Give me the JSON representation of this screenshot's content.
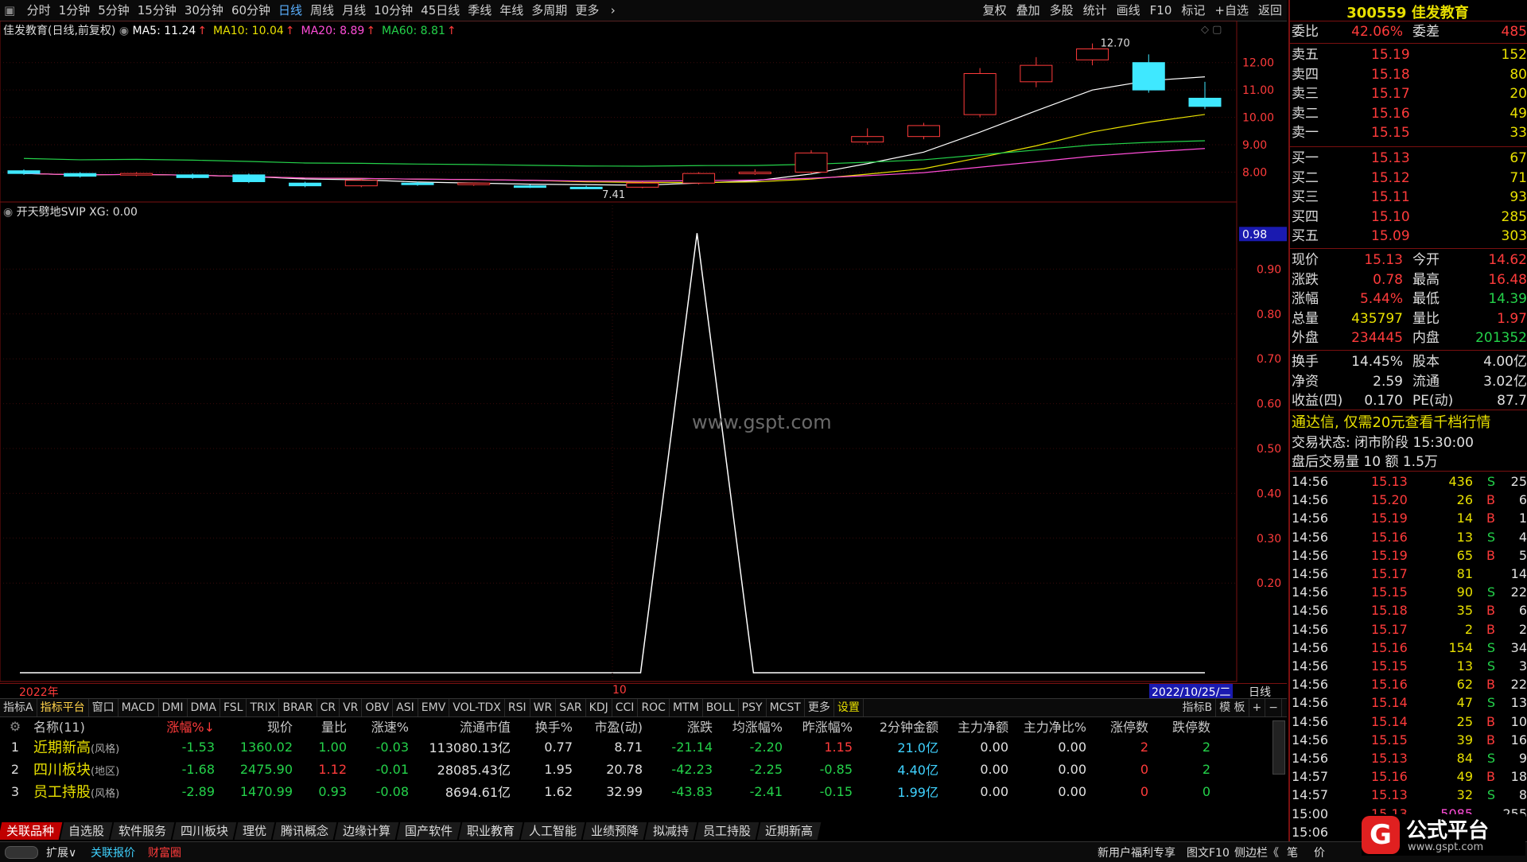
{
  "toolbar": {
    "periods": [
      "分时",
      "1分钟",
      "5分钟",
      "15分钟",
      "30分钟",
      "60分钟",
      "日线",
      "周线",
      "月线",
      "10分钟",
      "45日线",
      "季线",
      "年线",
      "多周期",
      "更多"
    ],
    "active": "日线",
    "right_tools": [
      "复权",
      "叠加",
      "多股",
      "统计",
      "画线",
      "F10",
      "标记",
      "+自选",
      "返回"
    ]
  },
  "chart": {
    "stock_title": "佳发教育(日线,前复权)",
    "ma": [
      {
        "label": "MA5: 11.24",
        "color": "#ffffff"
      },
      {
        "label": "MA10: 10.04",
        "color": "#e8e000"
      },
      {
        "label": "MA20: 8.89",
        "color": "#ff4dd8"
      },
      {
        "label": "MA60: 8.81",
        "color": "#24d24a"
      }
    ],
    "price_axis": [
      "12.00",
      "11.00",
      "10.00",
      "9.00",
      "8.00"
    ],
    "high_label": "12.70",
    "low_label": "7.41",
    "indicator_title": "开天劈地SVIP  XG: 0.00",
    "indicator_axis": [
      "0.98",
      "0.90",
      "0.80",
      "0.70",
      "0.60",
      "0.50",
      "0.40",
      "0.30",
      "0.20"
    ],
    "watermark": "www.gspt.com",
    "year_label": "2022年",
    "month_label": "10",
    "date_label": "2022/10/25/二",
    "period_label": "日线",
    "candles": [
      {
        "o": 8.05,
        "c": 7.95,
        "h": 8.1,
        "l": 7.9
      },
      {
        "o": 7.95,
        "c": 7.85,
        "h": 8.0,
        "l": 7.8
      },
      {
        "o": 7.9,
        "c": 7.95,
        "h": 8.0,
        "l": 7.85
      },
      {
        "o": 7.9,
        "c": 7.8,
        "h": 7.95,
        "l": 7.75
      },
      {
        "o": 7.9,
        "c": 7.65,
        "h": 7.95,
        "l": 7.6
      },
      {
        "o": 7.6,
        "c": 7.5,
        "h": 7.65,
        "l": 7.45
      },
      {
        "o": 7.5,
        "c": 7.7,
        "h": 7.75,
        "l": 7.45
      },
      {
        "o": 7.6,
        "c": 7.55,
        "h": 7.65,
        "l": 7.5
      },
      {
        "o": 7.55,
        "c": 7.6,
        "h": 7.62,
        "l": 7.5
      },
      {
        "o": 7.5,
        "c": 7.45,
        "h": 7.55,
        "l": 7.42
      },
      {
        "o": 7.45,
        "c": 7.41,
        "h": 7.5,
        "l": 7.41
      },
      {
        "o": 7.45,
        "c": 7.6,
        "h": 7.65,
        "l": 7.41
      },
      {
        "o": 7.6,
        "c": 7.95,
        "h": 8.0,
        "l": 7.55
      },
      {
        "o": 7.95,
        "c": 8.0,
        "h": 8.1,
        "l": 7.9
      },
      {
        "o": 8.0,
        "c": 8.7,
        "h": 8.8,
        "l": 7.95
      },
      {
        "o": 9.1,
        "c": 9.3,
        "h": 9.6,
        "l": 9.0
      },
      {
        "o": 9.3,
        "c": 9.7,
        "h": 9.8,
        "l": 9.2
      },
      {
        "o": 10.1,
        "c": 11.6,
        "h": 11.8,
        "l": 10.0
      },
      {
        "o": 11.3,
        "c": 11.9,
        "h": 12.2,
        "l": 11.1
      },
      {
        "o": 12.1,
        "c": 12.5,
        "h": 12.7,
        "l": 11.9
      },
      {
        "o": 12.0,
        "c": 11.0,
        "h": 12.3,
        "l": 10.9
      },
      {
        "o": 10.7,
        "c": 10.4,
        "h": 11.3,
        "l": 10.3
      }
    ],
    "spike_values": [
      0,
      0,
      0,
      0,
      0,
      0,
      0,
      0,
      0,
      0,
      0,
      0,
      0.98,
      0,
      0,
      0,
      0,
      0,
      0,
      0,
      0,
      0
    ]
  },
  "indicator_tabs": [
    "指标A",
    "指标平台",
    "窗口",
    "MACD",
    "DMI",
    "DMA",
    "FSL",
    "TRIX",
    "BRAR",
    "CR",
    "VR",
    "OBV",
    "ASI",
    "EMV",
    "VOL-TDX",
    "RSI",
    "WR",
    "SAR",
    "KDJ",
    "CCI",
    "ROC",
    "MTM",
    "BOLL",
    "PSY",
    "MCST",
    "更多",
    "设置"
  ],
  "indicator_tabs_right": [
    "指标B",
    "模 板",
    "+",
    "−"
  ],
  "table": {
    "headers": [
      "名称(11)",
      "涨幅%↓",
      "现价",
      "量比",
      "涨速%",
      "流通市值",
      "换手%",
      "市盈(动)",
      "涨跌",
      "均涨幅%",
      "昨涨幅%",
      "2分钟金额",
      "主力净额",
      "主力净比%",
      "涨停数",
      "跌停数"
    ],
    "rows": [
      {
        "idx": "1",
        "name": "近期新高",
        "tag": "(风格)",
        "vals": [
          "-1.53",
          "1360.02",
          "1.00",
          "-0.03",
          "113080.13亿",
          "0.77",
          "8.71",
          "-21.14",
          "-2.20",
          "1.15",
          "21.0亿",
          "0.00",
          "0.00",
          "2",
          "2"
        ]
      },
      {
        "idx": "2",
        "name": "四川板块",
        "tag": "(地区)",
        "vals": [
          "-1.68",
          "2475.90",
          "1.12",
          "-0.01",
          "28085.43亿",
          "1.95",
          "20.78",
          "-42.23",
          "-2.25",
          "-0.85",
          "4.40亿",
          "0.00",
          "0.00",
          "0",
          "2"
        ]
      },
      {
        "idx": "3",
        "name": "员工持股",
        "tag": "(风格)",
        "vals": [
          "-2.89",
          "1470.99",
          "0.93",
          "-0.08",
          "8694.61亿",
          "1.62",
          "32.99",
          "-43.83",
          "-2.41",
          "-0.15",
          "1.99亿",
          "0.00",
          "0.00",
          "0",
          "0"
        ]
      }
    ]
  },
  "sector_tabs": [
    "关联品种",
    "自选股",
    "软件服务",
    "四川板块",
    "理优",
    "腾讯概念",
    "边缘计算",
    "国产软件",
    "职业教育",
    "人工智能",
    "业绩预降",
    "拟减持",
    "员工持股",
    "近期新高"
  ],
  "status_bar": {
    "left": [
      "扩展∨",
      "关联报价",
      "财富圈"
    ],
    "right": [
      "新用户福利专享",
      "图文F10",
      "侧边栏《",
      "笔",
      "价"
    ]
  },
  "quote": {
    "header": "300559 佳发教育",
    "weibi": {
      "label": "委比",
      "pct": "42.06%",
      "label2": "委差",
      "val": "485"
    },
    "asks": [
      {
        "label": "卖五",
        "price": "15.19",
        "vol": "152"
      },
      {
        "label": "卖四",
        "price": "15.18",
        "vol": "80"
      },
      {
        "label": "卖三",
        "price": "15.17",
        "vol": "20"
      },
      {
        "label": "卖二",
        "price": "15.16",
        "vol": "49"
      },
      {
        "label": "卖一",
        "price": "15.15",
        "vol": "33"
      }
    ],
    "bids": [
      {
        "label": "买一",
        "price": "15.13",
        "vol": "67"
      },
      {
        "label": "买二",
        "price": "15.12",
        "vol": "71"
      },
      {
        "label": "买三",
        "price": "15.11",
        "vol": "93"
      },
      {
        "label": "买四",
        "price": "15.10",
        "vol": "285"
      },
      {
        "label": "买五",
        "price": "15.09",
        "vol": "303"
      }
    ],
    "stats": [
      [
        "现价",
        "15.13",
        "今开",
        "14.62"
      ],
      [
        "涨跌",
        "0.78",
        "最高",
        "16.48"
      ],
      [
        "涨幅",
        "5.44%",
        "最低",
        "14.39"
      ],
      [
        "总量",
        "435797",
        "量比",
        "1.97"
      ],
      [
        "外盘",
        "234445",
        "内盘",
        "201352"
      ]
    ],
    "stats2": [
      [
        "换手",
        "14.45%",
        "股本",
        "4.00亿"
      ],
      [
        "净资",
        "2.59",
        "流通",
        "3.02亿"
      ],
      [
        "收益(四)",
        "0.170",
        "PE(动)",
        "87.7"
      ]
    ],
    "promo": "通达信, 仅需20元查看千档行情",
    "trade_status": "交易状态: 闭市阶段 15:30:00",
    "after_hours": "盘后交易量 10  额 1.5万",
    "ticks": [
      [
        "14:56",
        "15.13",
        "436",
        "S",
        "25"
      ],
      [
        "14:56",
        "15.20",
        "26",
        "B",
        "6"
      ],
      [
        "14:56",
        "15.19",
        "14",
        "B",
        "1"
      ],
      [
        "14:56",
        "15.16",
        "13",
        "S",
        "4"
      ],
      [
        "14:56",
        "15.19",
        "65",
        "B",
        "5"
      ],
      [
        "14:56",
        "15.17",
        "81",
        "",
        "14"
      ],
      [
        "14:56",
        "15.15",
        "90",
        "S",
        "22"
      ],
      [
        "14:56",
        "15.18",
        "35",
        "B",
        "6"
      ],
      [
        "14:56",
        "15.17",
        "2",
        "B",
        "2"
      ],
      [
        "14:56",
        "15.16",
        "154",
        "S",
        "34"
      ],
      [
        "14:56",
        "15.15",
        "13",
        "S",
        "3"
      ],
      [
        "14:56",
        "15.16",
        "62",
        "B",
        "22"
      ],
      [
        "14:56",
        "15.14",
        "47",
        "S",
        "13"
      ],
      [
        "14:56",
        "15.14",
        "25",
        "B",
        "10"
      ],
      [
        "14:56",
        "15.15",
        "39",
        "B",
        "16"
      ],
      [
        "14:56",
        "15.13",
        "84",
        "S",
        "9"
      ],
      [
        "14:57",
        "15.16",
        "49",
        "B",
        "18"
      ],
      [
        "14:57",
        "15.13",
        "32",
        "S",
        "8"
      ],
      [
        "15:00",
        "15.13",
        "5085",
        "",
        "255"
      ],
      [
        "15:06",
        "",
        "",
        "",
        ""
      ]
    ],
    "logo": "公式平台",
    "logo_url": "www.gspt.com"
  }
}
